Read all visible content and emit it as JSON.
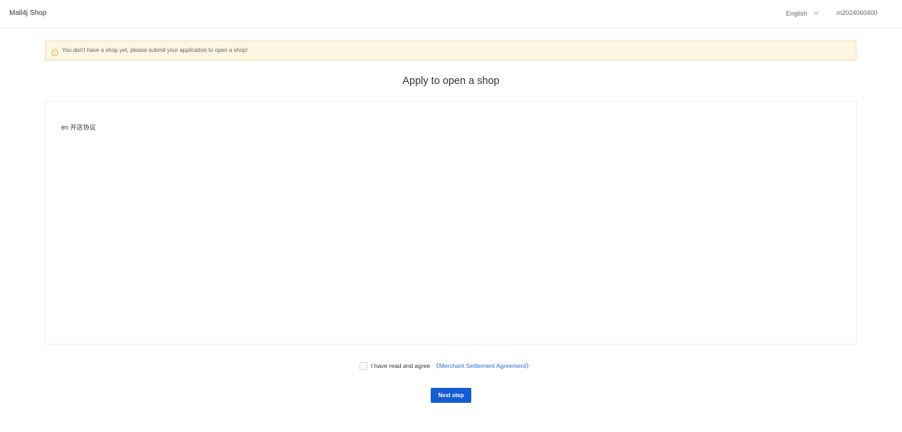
{
  "header": {
    "brand": "Mall4j Shop",
    "language": "English",
    "language_icon": "chevron-down-icon",
    "username": "m2024060400"
  },
  "alert": {
    "icon": "warning-icon",
    "message": "You don't have a shop yet, please submit your application to open a shop!"
  },
  "main": {
    "title": "Apply to open a shop",
    "agreement_content": "en 开店协议",
    "agree_label": "I have read and agree",
    "agree_link": "《Merchant Settlement Agreement》",
    "agree_checked": false,
    "next_button": "Next step"
  },
  "colors": {
    "primary": "#155bd4",
    "link": "#2f6ad8",
    "alert_bg": "#fdf6e2",
    "alert_border": "#f6dda0",
    "alert_icon": "#e6a23c"
  }
}
